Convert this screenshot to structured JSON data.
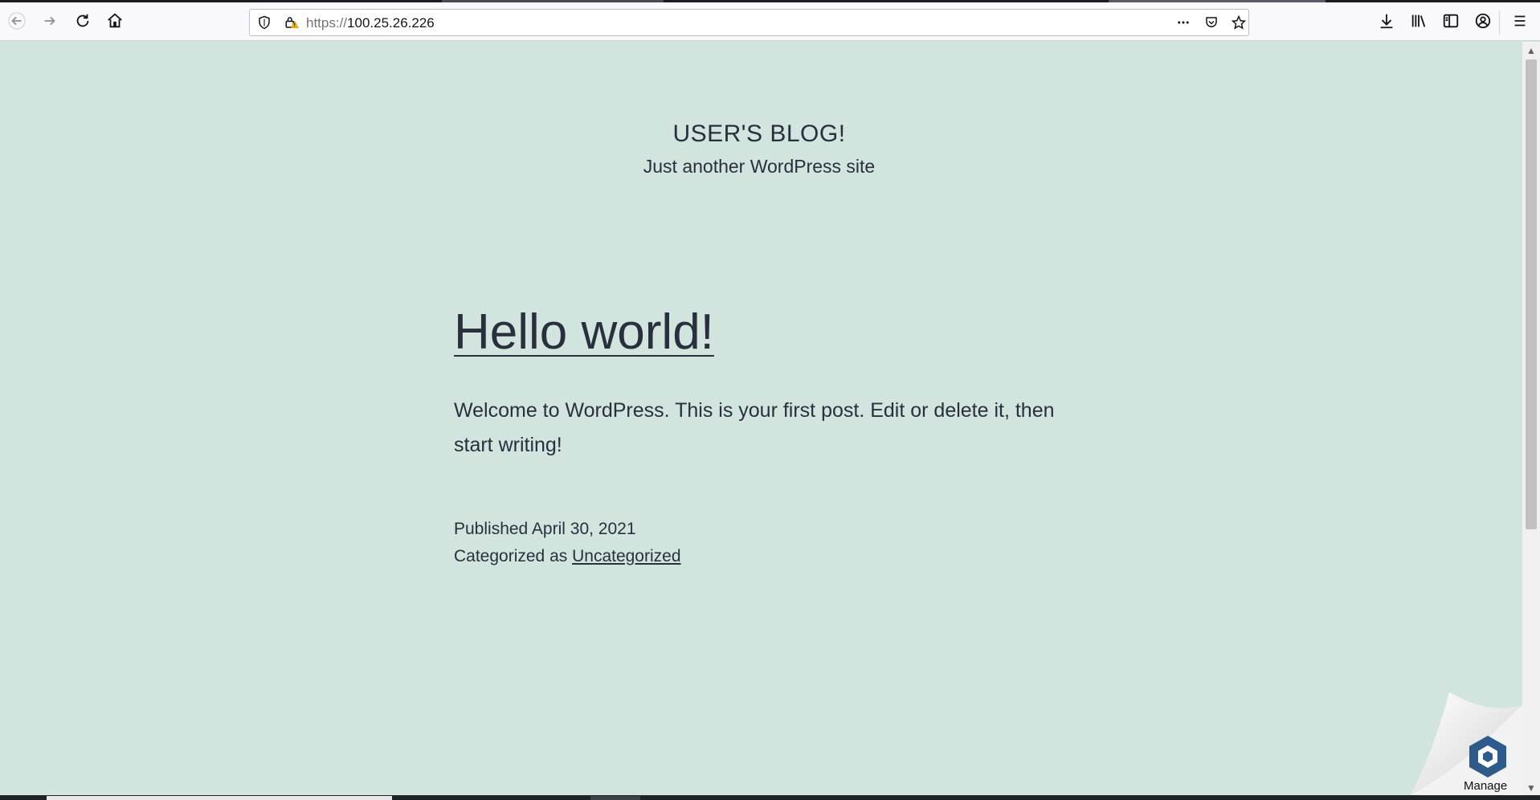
{
  "browser": {
    "url_scheme": "https://",
    "url_host": "100.25.26.226",
    "icons": {
      "back": "arrow-left-icon",
      "forward": "arrow-right-icon",
      "reload": "reload-icon",
      "home": "home-icon",
      "tracking": "shield-icon",
      "security": "insecure-lock-icon",
      "page_actions": "more-horizontal-icon",
      "pocket": "pocket-icon",
      "bookmark": "star-icon",
      "downloads": "download-icon",
      "library": "library-icon",
      "sidebar": "sidebar-icon",
      "account": "account-icon",
      "menu": "hamburger-menu-icon"
    }
  },
  "site": {
    "title": "USER'S BLOG!",
    "description": "Just another WordPress site"
  },
  "post": {
    "title": "Hello world!",
    "body": "Welcome to WordPress. This is your first post. Edit or delete it, then start writing!",
    "published_label": "Published",
    "published_date": "April 30, 2021",
    "categorized_label": "Categorized as",
    "category": "Uncategorized"
  },
  "widget": {
    "label": "Manage",
    "icon": "bitnami-logo-icon"
  },
  "colors": {
    "page_background": "#d1e4dd",
    "text": "#28303d",
    "toolbar": "#f9f9fb",
    "widget_blue": "#2d5b8c"
  }
}
